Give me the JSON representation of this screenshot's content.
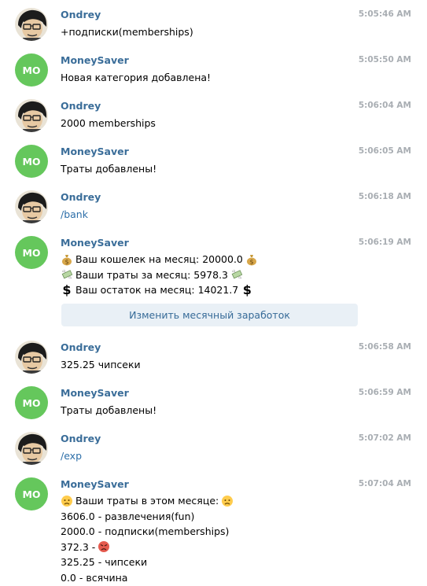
{
  "messages": [
    {
      "sender": "Ondrey",
      "time": "5:05:46 AM",
      "lines": [
        "+подписки(memberships)"
      ]
    },
    {
      "sender": "MoneySaver",
      "time": "5:05:50 AM",
      "lines": [
        "Новая категория добавлена!"
      ]
    },
    {
      "sender": "Ondrey",
      "time": "5:06:04 AM",
      "lines": [
        "2000 memberships"
      ]
    },
    {
      "sender": "MoneySaver",
      "time": "5:06:05 AM",
      "lines": [
        "Траты добавлены!"
      ]
    },
    {
      "sender": "Ondrey",
      "time": "5:06:18 AM",
      "lines": [
        "/bank"
      ]
    },
    {
      "sender": "MoneySaver",
      "time": "5:06:19 AM",
      "lines": [
        "Ваш кошелек на месяц: 20000.0",
        "Ваши траты за месяц: 5978.3",
        "Ваш остаток на месяц: 14021.7"
      ]
    },
    {
      "sender": "Ondrey",
      "time": "5:06:58 AM",
      "lines": [
        "325.25 чипсеки"
      ]
    },
    {
      "sender": "MoneySaver",
      "time": "5:06:59 AM",
      "lines": [
        "Траты добавлены!"
      ]
    },
    {
      "sender": "Ondrey",
      "time": "5:07:02 AM",
      "lines": [
        "/exp"
      ]
    },
    {
      "sender": "MoneySaver",
      "time": "5:07:04 AM",
      "lines": [
        "Ваши траты в этом месяце:",
        "3606.0 - развлечения(fun)",
        "2000.0 - подписки(memberships)",
        "372.3 -",
        "325.25 - чипсеки",
        "0.0 - всячина"
      ]
    }
  ],
  "bot_avatar_initials": "MO",
  "keyboard_button": "Изменить месячный заработок",
  "colors": {
    "name": "#3a6d99",
    "time": "#a9aeb3",
    "bot_avatar": "#65c75c",
    "link": "#2c6ea8",
    "keyboard_bg": "#e9f0f6"
  }
}
